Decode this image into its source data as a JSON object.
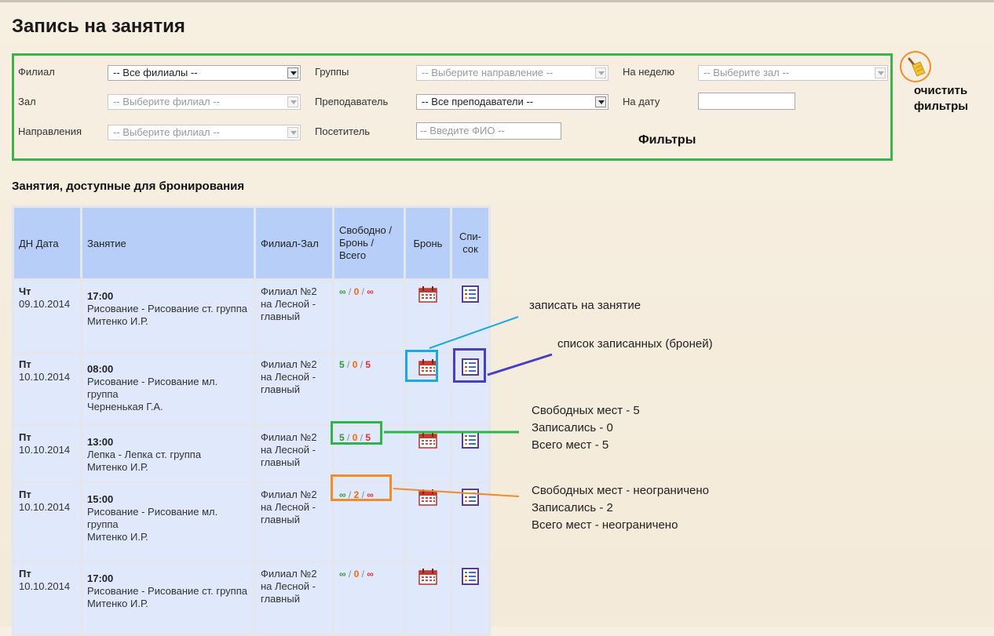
{
  "page": {
    "title": "Запись на занятия"
  },
  "filters": {
    "branch": {
      "label": "Филиал",
      "value": "-- Все филиалы --"
    },
    "hall": {
      "label": "Зал",
      "value": "-- Выберите филиал --"
    },
    "direction": {
      "label": "Направления",
      "value": "-- Выберите филиал --"
    },
    "groups": {
      "label": "Группы",
      "value": "-- Выберите направление --"
    },
    "teacher": {
      "label": "Преподаватель",
      "value": "-- Все преподаватели --"
    },
    "visitor": {
      "label": "Посетитель",
      "placeholder": "-- Введите ФИО --"
    },
    "week": {
      "label": "На неделю",
      "value": "-- Выберите зал --"
    },
    "date": {
      "label": "На дату",
      "value": ""
    },
    "caption": "Фильтры",
    "clear_label": "очистить фильтры"
  },
  "section_title": "Занятия, доступные для бронирования",
  "table": {
    "headers": {
      "date": "ДН Дата",
      "lesson": "Занятие",
      "place": "Филиал-Зал",
      "counts": "Свободно / Бронь / Всего",
      "book": "Бронь",
      "list": "Спи- сок"
    },
    "rows": [
      {
        "day": "Чт",
        "date": "09.10.2014",
        "time": "17:00",
        "lesson": "Рисование - Рисование ст. группа",
        "teacher": "Митенко И.Р.",
        "place": "Филиал №2 на Лесной - главный",
        "free": "∞",
        "booked": "0",
        "total": "∞"
      },
      {
        "day": "Пт",
        "date": "10.10.2014",
        "time": "08:00",
        "lesson": "Рисование - Рисование мл. группа",
        "teacher": "Черненькая Г.А.",
        "place": "Филиал №2 на Лесной - главный",
        "free": "5",
        "booked": "0",
        "total": "5"
      },
      {
        "day": "Пт",
        "date": "10.10.2014",
        "time": "13:00",
        "lesson": "Лепка - Лепка ст. группа",
        "teacher": "Митенко И.Р.",
        "place": "Филиал №2 на Лесной - главный",
        "free": "5",
        "booked": "0",
        "total": "5"
      },
      {
        "day": "Пт",
        "date": "10.10.2014",
        "time": "15:00",
        "lesson": "Рисование - Рисование мл. группа",
        "teacher": "Митенко И.Р.",
        "place": "Филиал №2 на Лесной - главный",
        "free": "∞",
        "booked": "2",
        "total": "∞"
      },
      {
        "day": "Пт",
        "date": "10.10.2014",
        "time": "17:00",
        "lesson": "Рисование - Рисование ст. группа",
        "teacher": "Митенко И.Р.",
        "place": "Филиал №2 на Лесной - главный",
        "free": "∞",
        "booked": "0",
        "total": "∞"
      }
    ]
  },
  "annotations": {
    "book": "записать на занятие",
    "list": "список записанных (броней)",
    "counts_limited": {
      "line1": "Свободных мест - 5",
      "line2": "Записались - 0",
      "line3": "Всего мест - 5"
    },
    "counts_unlimited": {
      "line1": "Свободных мест - неограничено",
      "line2": "Записались - 2",
      "line3": "Всего мест - неограничено"
    }
  },
  "colors": {
    "filters_border": "#3bb34a",
    "header_bg": "#b7cff8",
    "cell_bg": "#dfe9fb",
    "free": "#2e9e2e",
    "booked": "#ff6600",
    "total": "#e0303a",
    "ann_book": "#1ea7e0",
    "ann_list": "#4a3fc1",
    "ann_limited": "#2fb34a",
    "ann_unlimited": "#f28c28"
  },
  "icons": {
    "book": "calendar-icon",
    "list": "list-icon",
    "clear": "broom-icon"
  }
}
